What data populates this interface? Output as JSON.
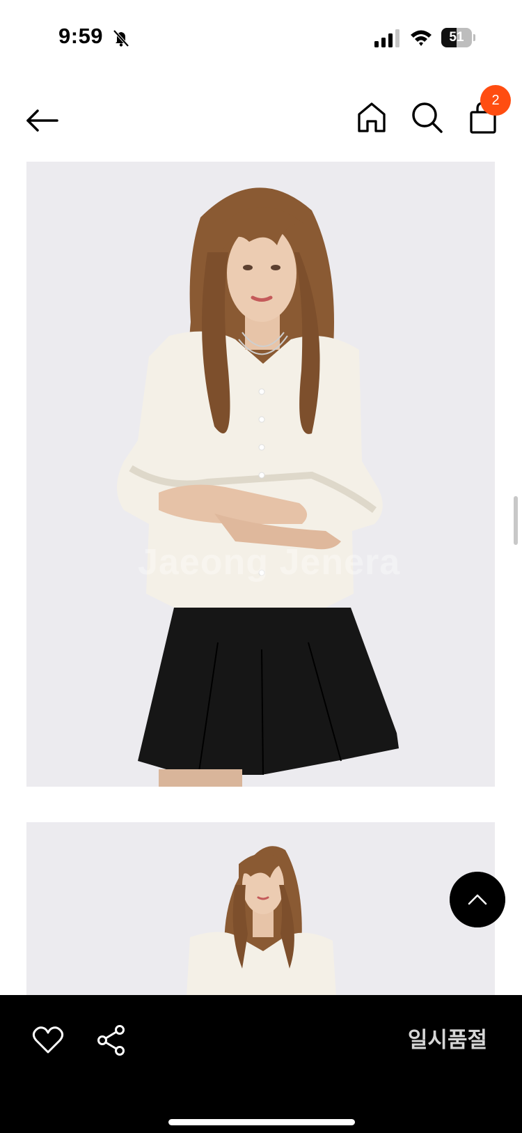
{
  "status_bar": {
    "time": "9:59",
    "battery": "51",
    "battery_level": 0.51,
    "icons": [
      "bell-off-icon",
      "signal-icon",
      "wifi-icon",
      "battery-icon"
    ]
  },
  "header": {
    "icons": [
      "back-arrow-icon",
      "home-icon",
      "search-icon",
      "shopping-bag-icon"
    ],
    "cart_count": "2"
  },
  "product": {
    "watermark": "Jaeong Jenera",
    "images": [
      "model-front-photo",
      "model-front-full-photo"
    ]
  },
  "bottom_bar": {
    "icons": [
      "heart-icon",
      "share-icon"
    ],
    "status_label": "일시품절"
  },
  "colors": {
    "accent": "#ff4d11",
    "bottom_bar_bg": "#000000",
    "image_bg": "#ecebef"
  }
}
